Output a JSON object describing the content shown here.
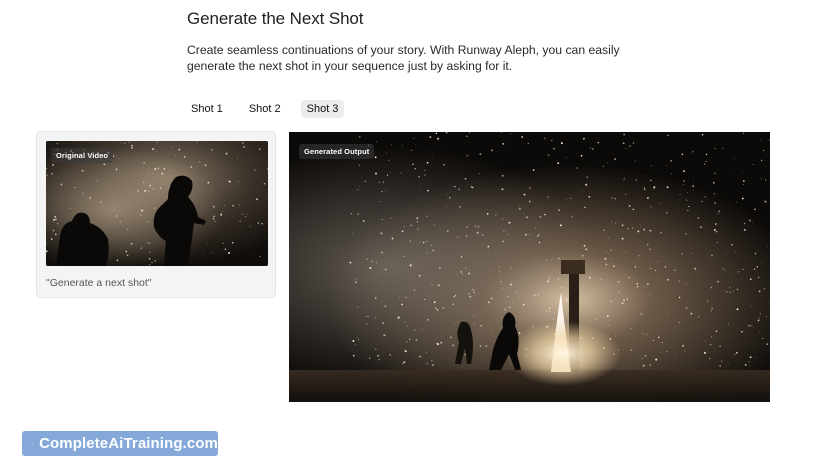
{
  "page": {
    "title": "Generate the Next Shot",
    "description": "Create seamless continuations of your story. With Runway Aleph, you can easily generate the next shot in your sequence just by asking for it."
  },
  "tabs": [
    {
      "label": "Shot 1",
      "active": false
    },
    {
      "label": "Shot 2",
      "active": false
    },
    {
      "label": "Shot 3",
      "active": true
    }
  ],
  "input_card": {
    "video_label": "Original Video",
    "prompt": "\"Generate a next shot\""
  },
  "output": {
    "video_label": "Generated Output"
  },
  "watermark": {
    "text": "CompleteAiTraining.com",
    "icon": "sparkle-logo-icon",
    "color": "#7ea5d8"
  }
}
